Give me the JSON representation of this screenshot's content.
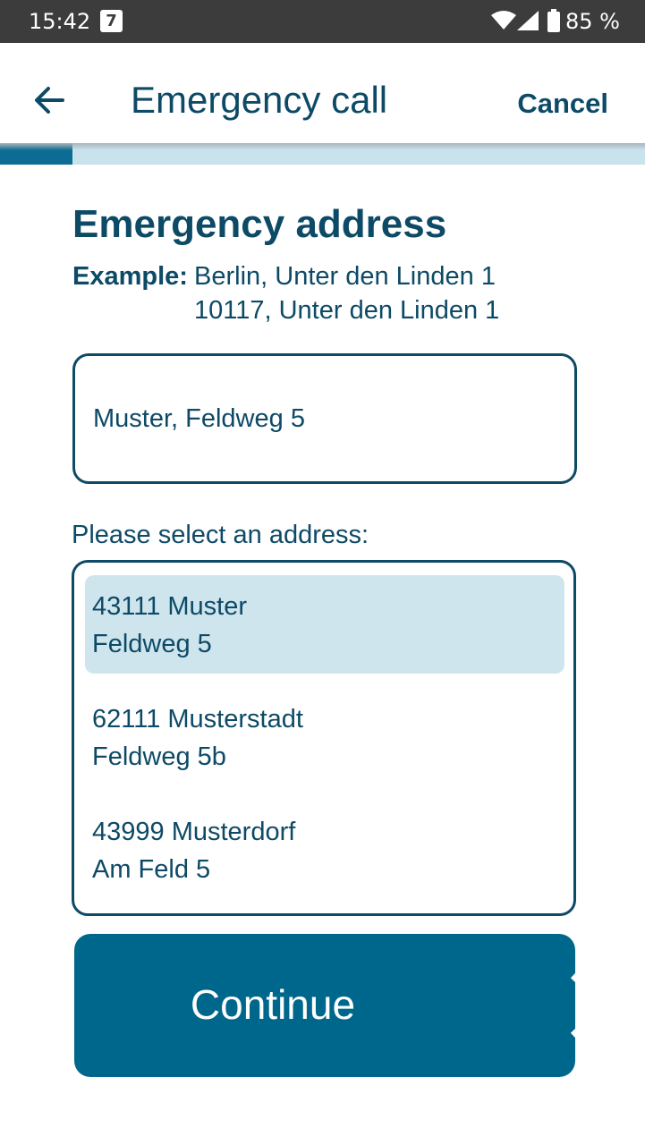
{
  "status_bar": {
    "time": "15:42",
    "calendar_day": "7",
    "battery": "85 %"
  },
  "app_bar": {
    "title": "Emergency call",
    "cancel_label": "Cancel"
  },
  "progress": {
    "fraction": 0.112
  },
  "section": {
    "title": "Emergency address",
    "example_label": "Example:",
    "example_line1": "Berlin, Unter den Linden 1",
    "example_line2": "10117, Unter den Linden 1"
  },
  "address_input": {
    "value": "Muster, Feldweg 5"
  },
  "selection": {
    "label": "Please select an address:",
    "items": [
      {
        "line1": "43111 Muster",
        "line2": "Feldweg 5",
        "selected": true
      },
      {
        "line1": "62111 Musterstadt",
        "line2": "Feldweg 5b",
        "selected": false
      },
      {
        "line1": "43999 Musterdorf",
        "line2": "Am Feld 5",
        "selected": false
      }
    ]
  },
  "continue_button": {
    "label": "Continue"
  },
  "colors": {
    "primary": "#00678c",
    "text": "#0d4a66",
    "selected_bg": "#cfe5ee",
    "status_bar": "#3c3c3c"
  },
  "icons": {
    "back": "arrow-left-icon",
    "calendar": "calendar-icon",
    "wifi": "wifi-icon",
    "signal": "signal-icon",
    "battery": "battery-icon",
    "continue": "chevron-right-icon"
  }
}
